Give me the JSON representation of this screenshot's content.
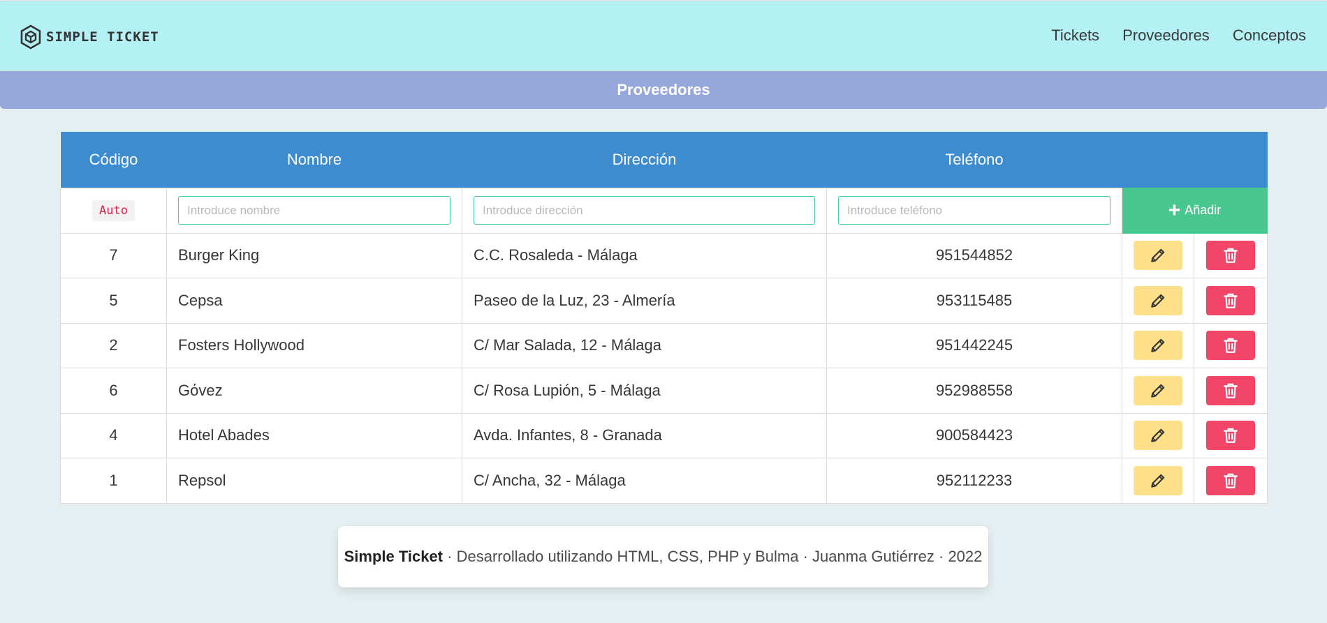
{
  "brand": {
    "name": "SIMPLE TICKET",
    "logo_icon": "hexagon-cube-icon"
  },
  "nav": {
    "links": [
      "Tickets",
      "Proveedores",
      "Conceptos"
    ]
  },
  "section": {
    "title": "Proveedores"
  },
  "colors": {
    "navbar": "#b4f1f4",
    "section_bar": "#96a7db",
    "table_header": "#3d8ccf",
    "add_button": "#48c78e",
    "edit_button": "#ffe08a",
    "delete_button": "#f14668",
    "background": "#e5eff1"
  },
  "table": {
    "columns": [
      "Código",
      "Nombre",
      "Dirección",
      "Teléfono"
    ],
    "new_row": {
      "code": "Auto",
      "name_placeholder": "Introduce nombre",
      "address_placeholder": "Introduce dirección",
      "phone_placeholder": "Introduce teléfono",
      "add_label": "Añadir",
      "add_icon": "plus-icon"
    },
    "rows": [
      {
        "code": "7",
        "name": "Burger King",
        "address": "C.C. Rosaleda - Málaga",
        "phone": "951544852"
      },
      {
        "code": "5",
        "name": "Cepsa",
        "address": "Paseo de la Luz, 23 - Almería",
        "phone": "953115485"
      },
      {
        "code": "2",
        "name": "Fosters Hollywood",
        "address": "C/ Mar Salada, 12 - Málaga",
        "phone": "951442245"
      },
      {
        "code": "6",
        "name": "Gόvez",
        "address": "C/ Rosa Lupión, 5 - Málaga",
        "phone": "952988558"
      },
      {
        "code": "4",
        "name": "Hotel Abades",
        "address": "Avda. Infantes, 8 - Granada",
        "phone": "900584423"
      },
      {
        "code": "1",
        "name": "Repsol",
        "address": "C/ Ancha, 32 - Málaga",
        "phone": "952112233"
      }
    ],
    "row_actions": {
      "edit_icon": "pencil-icon",
      "delete_icon": "trash-icon"
    }
  },
  "footer": {
    "brand": "Simple Ticket",
    "text": " · Desarrollado utilizando HTML, CSS, PHP y Bulma · Juanma Gutiérrez · 2022"
  }
}
